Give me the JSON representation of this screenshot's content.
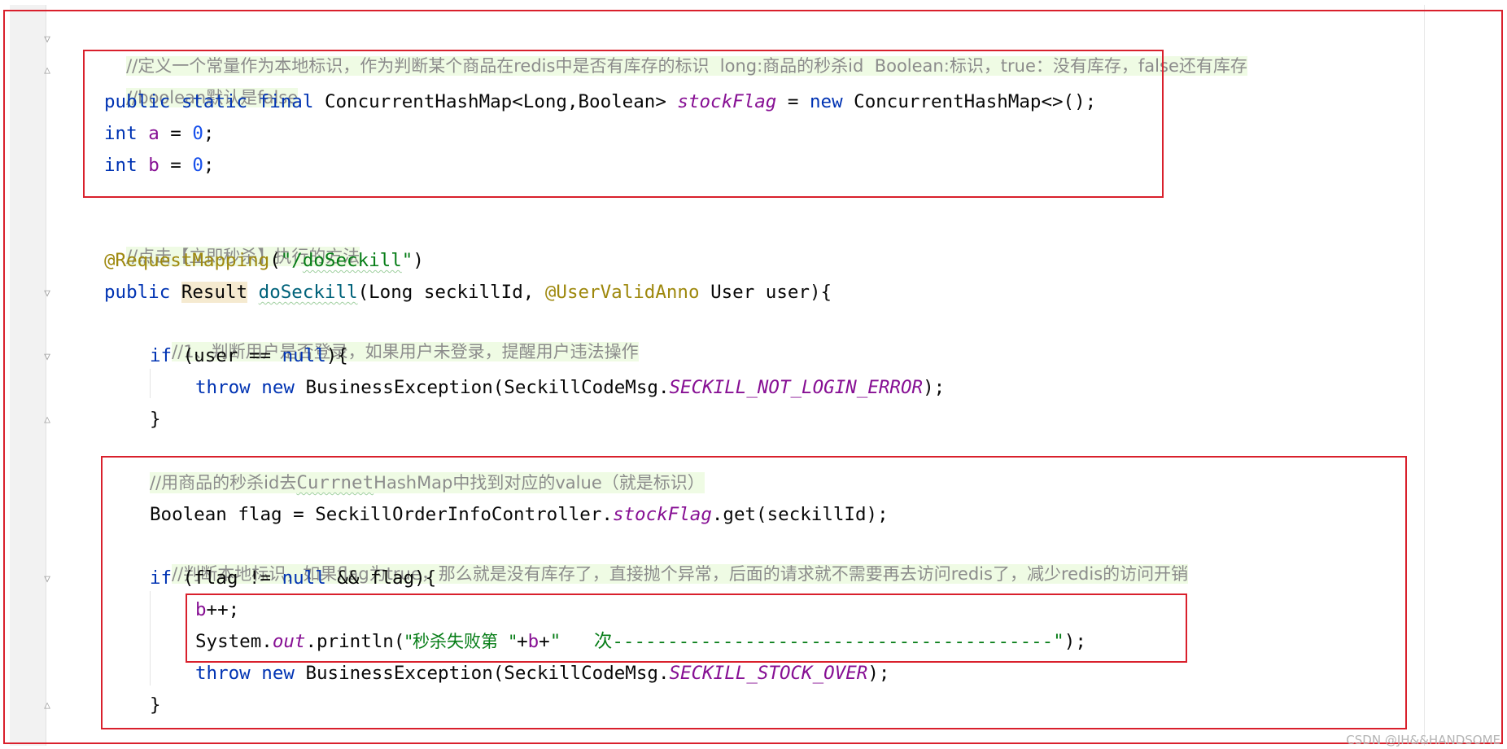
{
  "editor": {
    "line1": {
      "comment": "//定义一个常量作为本地标识，作为判断某个商品在redis中是否有库存的标识  long:商品的秒杀id  Boolean:标识，true：没有库存，false还有库存"
    },
    "line2": {
      "comment": "//boolean默认是false"
    },
    "line3": {
      "kw1": "public static final ",
      "type1": "ConcurrentHashMap<Long,Boolean> ",
      "field": "stockFlag",
      "op": " = ",
      "kw2": "new ",
      "rest": "ConcurrentHashMap<>();"
    },
    "line4": {
      "kw": "int ",
      "var": "a",
      "op": " = ",
      "num": "0",
      "end": ";"
    },
    "line5": {
      "kw": "int ",
      "var": "b",
      "op": " = ",
      "num": "0",
      "end": ";"
    },
    "line7": {
      "comment": "//点击【立即秒杀】执行的方法"
    },
    "line8": {
      "anno": "@RequestMapping",
      "open": "(",
      "str_a": "\"/",
      "str_b": "doSeckill",
      "str_c": "\"",
      "close": ")"
    },
    "line9": {
      "kw": "public ",
      "type": "Result",
      "sp": " ",
      "method": "doSeckill",
      "params1": "(Long seckillId, ",
      "anno": "@UserValidAnno",
      "params2": " User user){"
    },
    "line10": {
      "comment": "//1、判断用户是否登录，如果用户未登录，提醒用户违法操作"
    },
    "line11": {
      "kw": "if ",
      "a": "(user == ",
      "kw2": "null",
      "b": "){"
    },
    "line12": {
      "kw": "throw new ",
      "a": "BusinessException(SeckillCodeMsg.",
      "field": "SECKILL_NOT_LOGIN_ERROR",
      "b": ");"
    },
    "line13": {
      "text": "}"
    },
    "line15": {
      "comment_a": "//用商品的秒杀id去",
      "comment_b": "Currnet",
      "comment_c": "HashMap中找到对应的value（就是标识）"
    },
    "line16": {
      "a": "Boolean flag = SeckillOrderInfoController.",
      "field": "stockFlag",
      "b": ".get(seckillId);"
    },
    "line17": {
      "comment": "//判断本地标识，如果flag为true，那么就是没有库存了，直接抛个异常，后面的请求就不需要再去访问redis了，减少redis的访问开销"
    },
    "line18": {
      "kw": "if ",
      "a": "(flag != ",
      "kw2": "null",
      "b": " && flag){"
    },
    "line19": {
      "field": "b",
      "rest": "++;"
    },
    "line20": {
      "a": "System.",
      "field": "out",
      "b": ".println(",
      "str1": "\"秒杀失败第  \"",
      "plus1": "+",
      "var": "b",
      "plus2": "+",
      "str2": "\"   次----------------------------------------\"",
      "c": ");"
    },
    "line21": {
      "kw": "throw new ",
      "a": "BusinessException(SeckillCodeMsg.",
      "field": "SECKILL_STOCK_OVER",
      "b": ");"
    },
    "line22": {
      "text": "}"
    }
  },
  "gutter": {
    "fold_open": "▽",
    "fold_close": "△"
  },
  "watermark": "CSDN @JH&&HANDSOME",
  "colors": {
    "highlight_border": "#d9202c",
    "keyword": "#0033b3",
    "comment": "#8c8c8c",
    "comment_bg": "#effbe4",
    "string": "#067d17",
    "field": "#871094",
    "annotation": "#9e880d",
    "number": "#1750eb"
  }
}
